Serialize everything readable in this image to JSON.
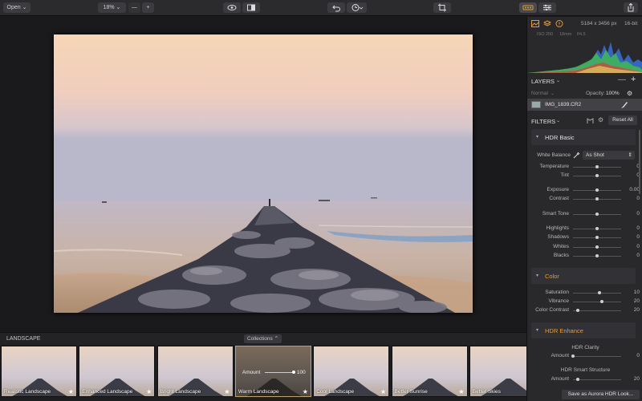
{
  "toolbar": {
    "open_label": "Open",
    "zoom_value": "18%",
    "zoom_minus": "—",
    "zoom_plus": "+"
  },
  "photo": {
    "description_colors": {
      "sky_top": "#f4d1b0",
      "sky_mid": "#e8c8c8",
      "sky_low": "#c8c4d6",
      "sea": "#9aa0b0",
      "sand": "#c9a07a",
      "rocks": "#3a3a44"
    }
  },
  "filmstrip": {
    "category": "LANDSCAPE",
    "collections_label": "Collections",
    "amount_label": "Amount",
    "amount_value": "100",
    "items": [
      {
        "label": "Realistic Landscape"
      },
      {
        "label": "Enhanced Landscape"
      },
      {
        "label": "Bright Landscape"
      },
      {
        "label": "Warm Landscape",
        "selected": true
      },
      {
        "label": "Cool Landscape"
      },
      {
        "label": "Better Sunrise"
      },
      {
        "label": "Better Skies"
      }
    ]
  },
  "info": {
    "dimensions": "5184 x 3456 px",
    "bitdepth": "16-bit",
    "iso": "ISO 200",
    "focal": "18mm",
    "aperture": "f/4.5"
  },
  "layers": {
    "title": "LAYERS",
    "blend_mode": "Normal",
    "opacity_label": "Opacity:",
    "opacity_value": "100%",
    "layer_name": "IMG_1839.CR2"
  },
  "filters": {
    "title": "FILTERS",
    "reset_label": "Reset All",
    "hdr_basic": {
      "title": "HDR Basic",
      "white_balance_label": "White Balance",
      "white_balance_value": "As Shot",
      "rows": [
        {
          "label": "Temperature",
          "value": "0",
          "pos": 0.5
        },
        {
          "label": "Tint",
          "value": "0",
          "pos": 0.5
        },
        {
          "label": "Exposure",
          "value": "0.00",
          "pos": 0.5
        },
        {
          "label": "Contrast",
          "value": "0",
          "pos": 0.5
        },
        {
          "label": "Smart Tone",
          "value": "0",
          "pos": 0.5
        },
        {
          "label": "Highlights",
          "value": "0",
          "pos": 0.5
        },
        {
          "label": "Shadows",
          "value": "0",
          "pos": 0.5
        },
        {
          "label": "Whites",
          "value": "0",
          "pos": 0.5
        },
        {
          "label": "Blacks",
          "value": "0",
          "pos": 0.5
        }
      ]
    },
    "color": {
      "title": "Color",
      "rows": [
        {
          "label": "Saturation",
          "value": "10",
          "pos": 0.55
        },
        {
          "label": "Vibrance",
          "value": "20",
          "pos": 0.6
        },
        {
          "label": "Color Contrast",
          "value": "20",
          "pos": 0.1
        }
      ]
    },
    "hdr_enhance": {
      "title": "HDR Enhance",
      "clarity_title": "HDR Clarity",
      "smart_structure_title": "HDR Smart Structure",
      "rows": [
        {
          "label": "Amount",
          "value": "0",
          "pos": 0.0
        },
        {
          "label": "Amount",
          "value": "20",
          "pos": 0.1
        }
      ]
    }
  },
  "save_look_label": "Save as Aurora HDR Look...",
  "colors": {
    "accent": "#e89a2e",
    "selection": "#c7a150"
  }
}
